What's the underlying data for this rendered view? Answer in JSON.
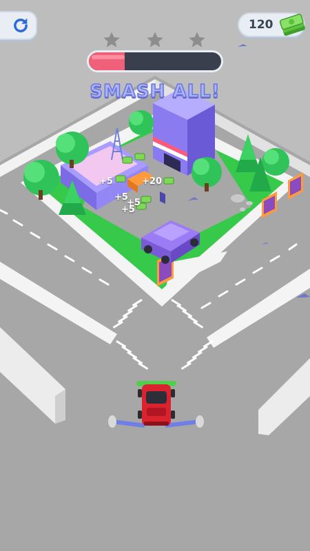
{
  "hud": {
    "money": "120",
    "stars_total": 3,
    "stars_earned": 0,
    "progress_fraction": 0.27,
    "objective": "SMASH ALL!"
  },
  "popups": [
    "+5",
    "+20",
    "+5",
    "+5",
    "+5"
  ],
  "icons": {
    "restart": "restart-icon",
    "cash": "cash-stack-icon",
    "star": "star-icon"
  },
  "colors": {
    "progress_fill": "#f0607a",
    "progress_track": "#3a3f4d",
    "objective_text": "#aab4ff",
    "car": "#d9232e",
    "building": "#8a7cf0",
    "grass": "#36c94a",
    "road": "#a6a6a6"
  }
}
